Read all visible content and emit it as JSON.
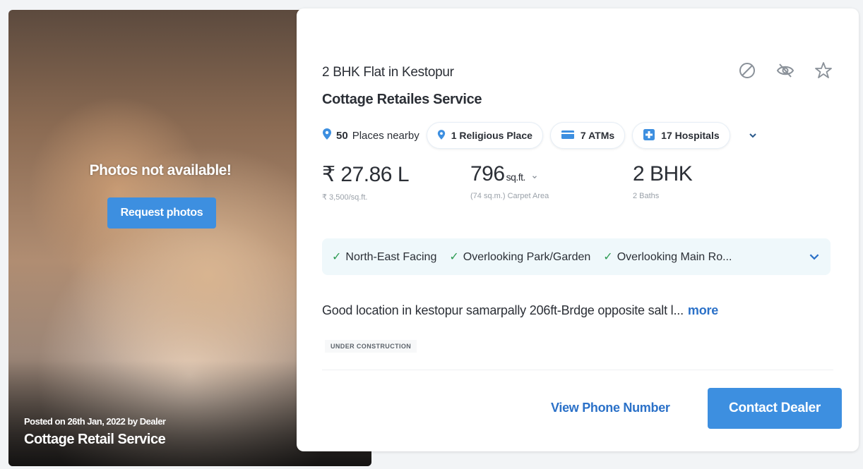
{
  "photo": {
    "unavailable_text": "Photos not available!",
    "request_label": "Request photos",
    "posted_text": "Posted on 26th Jan, 2022 by Dealer",
    "dealer_name": "Cottage Retail Service"
  },
  "listing": {
    "title": "2 BHK Flat in Kestopur",
    "seller": "Cottage Retailes Service",
    "nearby": {
      "summary_count": "50",
      "summary_label": "Places nearby",
      "chips": [
        {
          "icon": "location-pin-icon",
          "label": "1 Religious Place"
        },
        {
          "icon": "atm-card-icon",
          "label": "7 ATMs"
        },
        {
          "icon": "hospital-cross-icon",
          "label": "17 Hospitals"
        }
      ]
    },
    "price": {
      "value": "₹ 27.86 L",
      "per_sqft": "₹ 3,500/sq.ft."
    },
    "area": {
      "value": "796",
      "unit": "sq.ft.",
      "sub": "(74 sq.m.) Carpet Area"
    },
    "config": {
      "value": "2 BHK",
      "sub": "2 Baths"
    },
    "features": [
      "North-East Facing",
      "Overlooking Park/Garden",
      "Overlooking Main Ro..."
    ],
    "description": "Good location in kestopur samarpally 206ft-Brdge opposite salt l...",
    "more_label": "more",
    "status_badge": "UNDER CONSTRUCTION",
    "phone_label": "View Phone Number",
    "contact_label": "Contact Dealer"
  },
  "colors": {
    "accent": "#3d8fe0",
    "link": "#2b71c8",
    "check": "#2e9b53"
  }
}
